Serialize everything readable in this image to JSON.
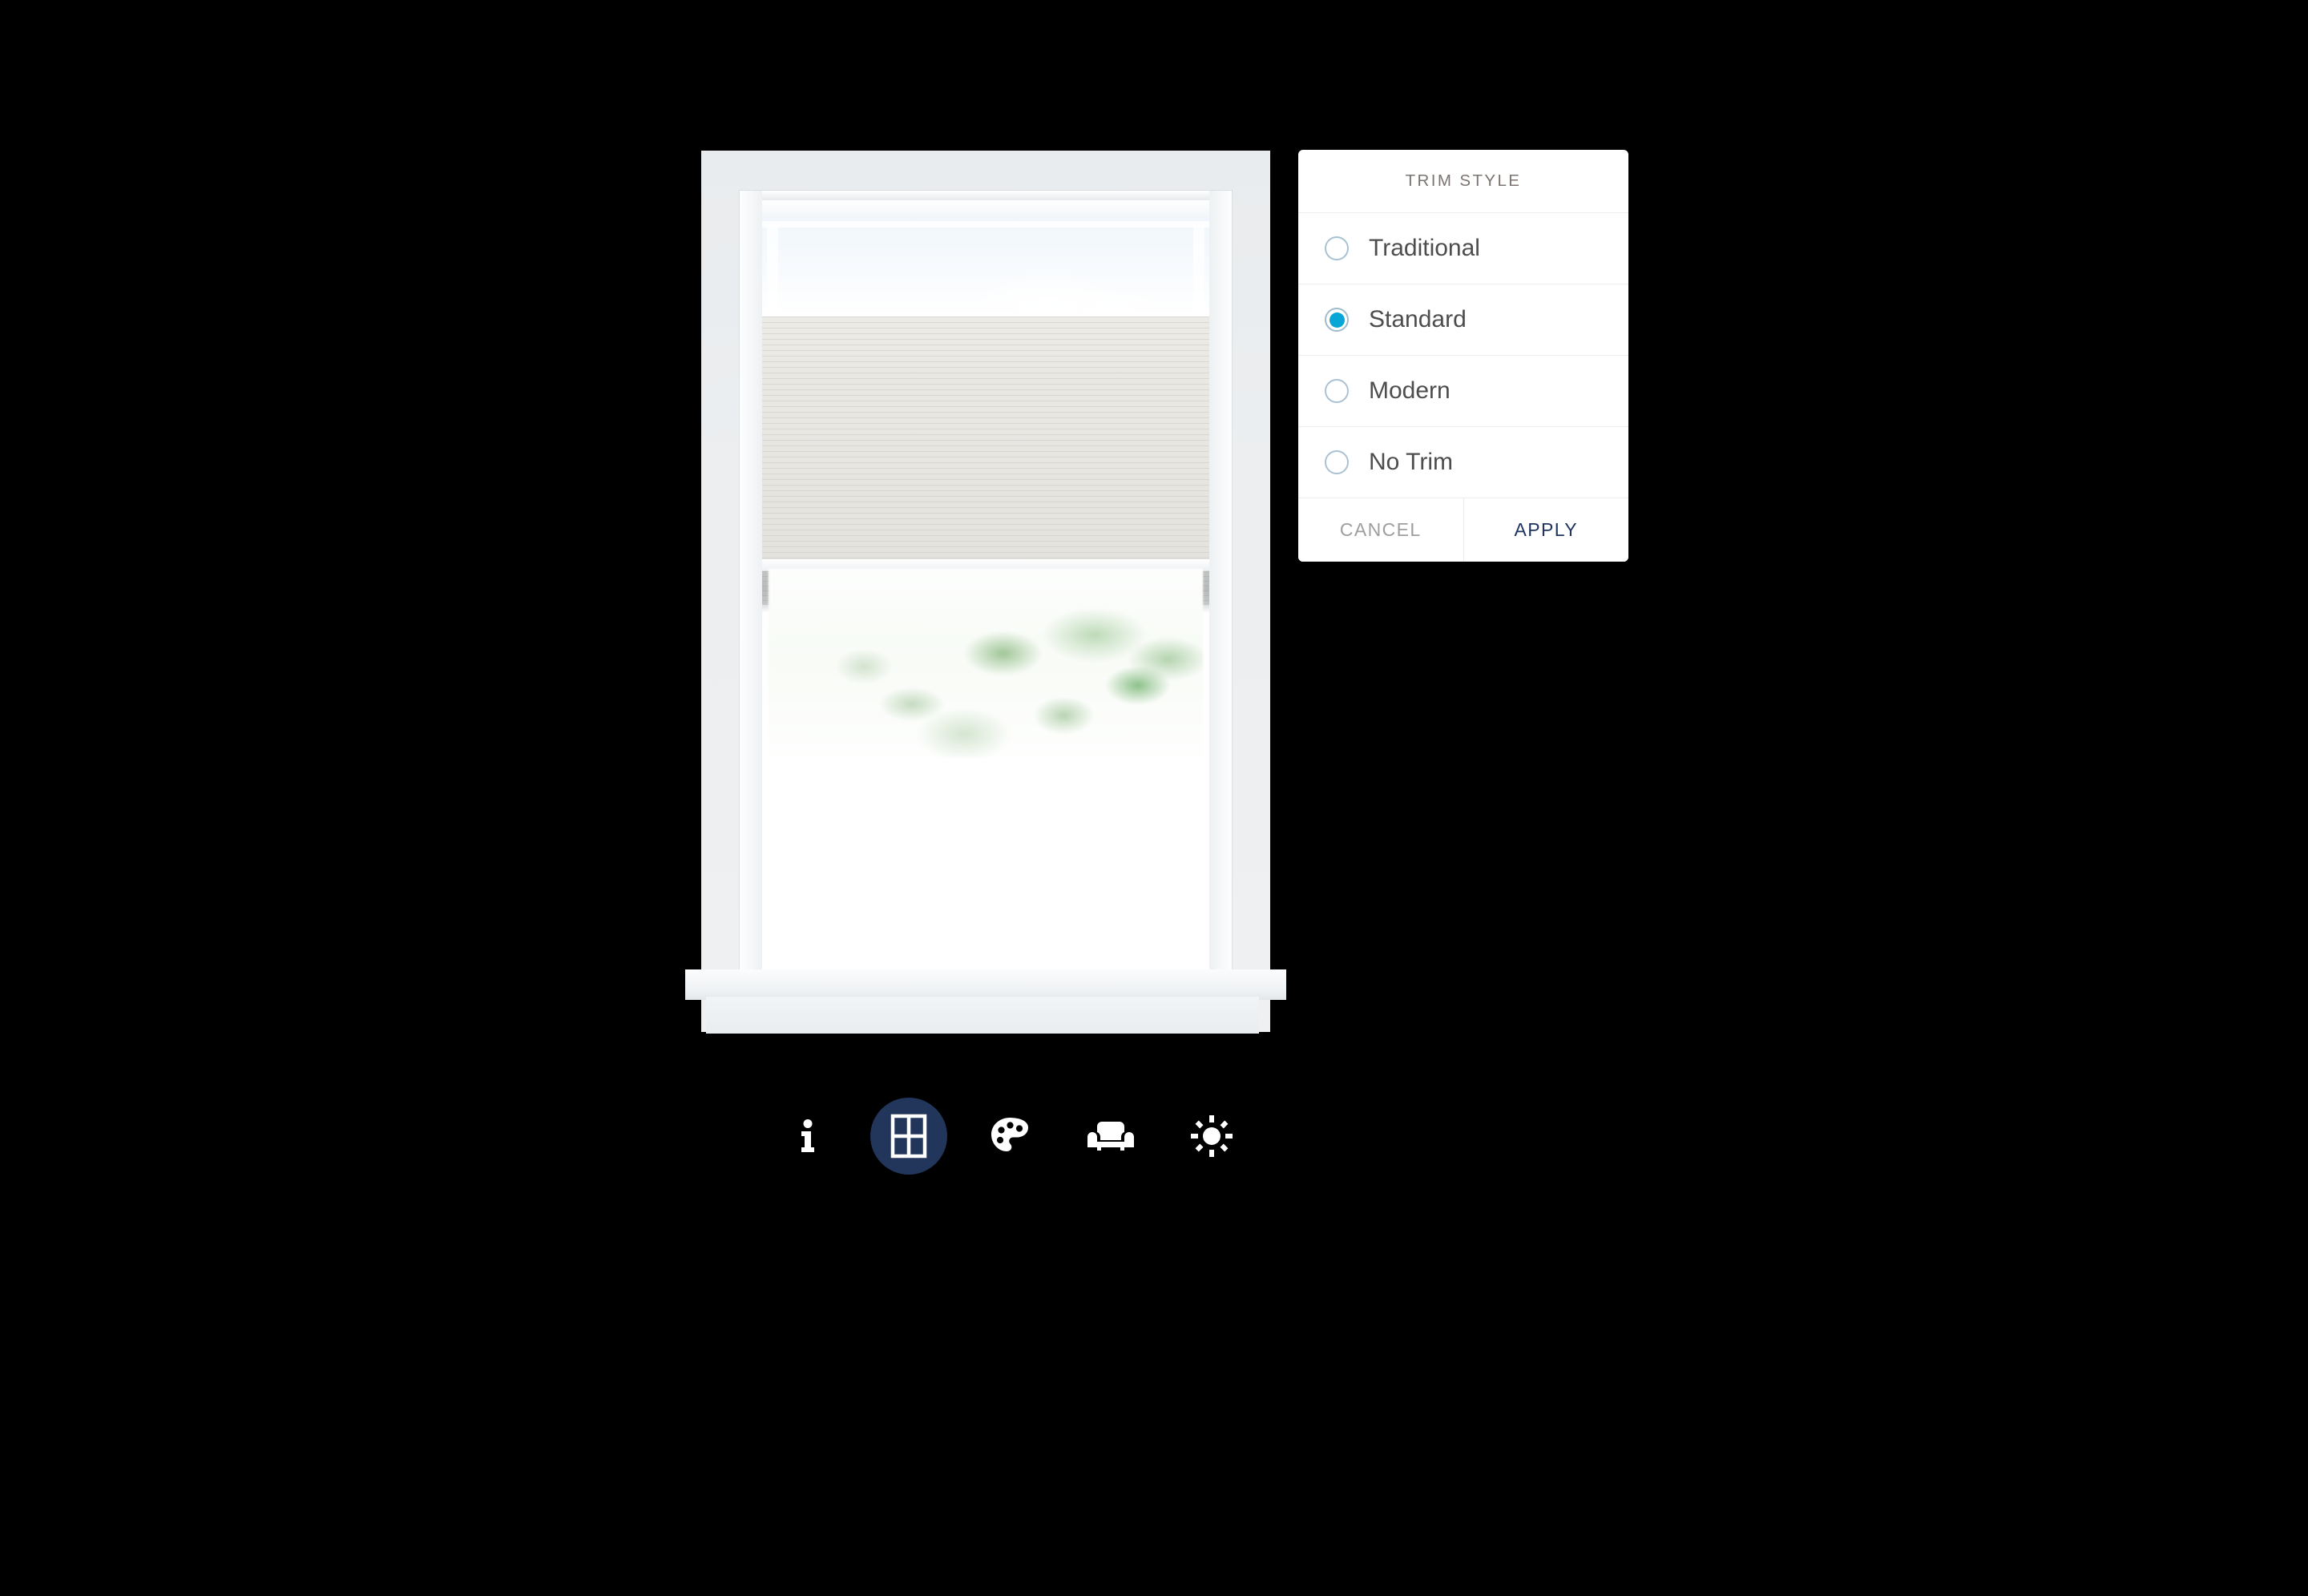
{
  "app": {
    "background_color": "#000000",
    "accent_navy": "#22365c",
    "accent_cyan": "#07a6d6"
  },
  "scene": {
    "name": "window-visualizer-preview",
    "description": "Room window with cellular shade partially lowered",
    "shade_color": "#eceae5",
    "trim_color": "#f7f9fa",
    "wall_color": "#eceef0"
  },
  "dialog": {
    "title": "TRIM STYLE",
    "selected_index": 1,
    "options": [
      {
        "label": "Traditional",
        "selected": false
      },
      {
        "label": "Standard",
        "selected": true
      },
      {
        "label": "Modern",
        "selected": false
      },
      {
        "label": "No Trim",
        "selected": false
      }
    ],
    "cancel_label": "CANCEL",
    "apply_label": "APPLY"
  },
  "toolbar": {
    "active_index": 1,
    "items": [
      {
        "icon": "info-icon",
        "name": "tool-info",
        "active": false
      },
      {
        "icon": "window-icon",
        "name": "tool-window",
        "active": true
      },
      {
        "icon": "palette-icon",
        "name": "tool-color",
        "active": false
      },
      {
        "icon": "sofa-icon",
        "name": "tool-room",
        "active": false
      },
      {
        "icon": "sun-icon",
        "name": "tool-lighting",
        "active": false
      }
    ]
  }
}
